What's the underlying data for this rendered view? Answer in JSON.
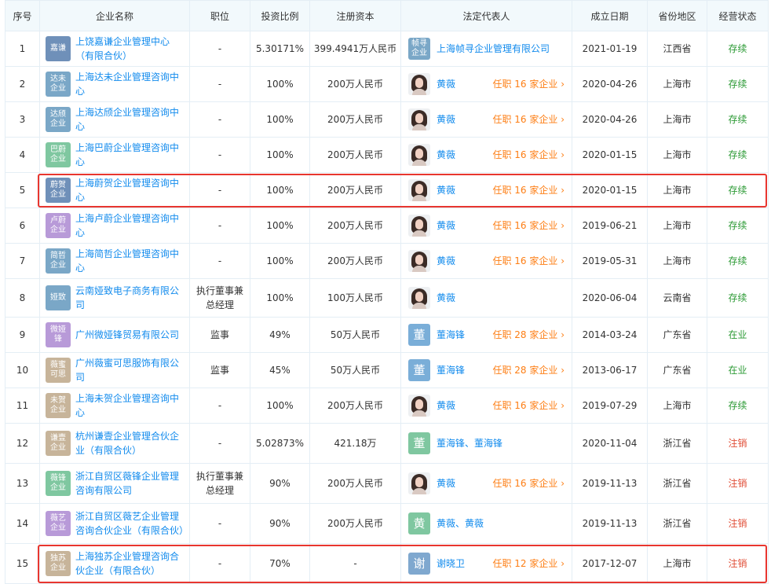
{
  "table": {
    "headers": [
      "序号",
      "企业名称",
      "职位",
      "投资比例",
      "注册资本",
      "法定代表人",
      "成立日期",
      "省份地区",
      "经营状态"
    ],
    "rows": [
      {
        "no": "1",
        "logo_text": "嘉谦",
        "logo_color": "#6f90b9",
        "name": "上饶嘉谦企业管理中心（有限合伙）",
        "position": "-",
        "ratio": "5.30171%",
        "capital": "399.4941万人民币",
        "rep_avatar": "帧寻企业",
        "rep_color": "#7aa7c7",
        "rep": "上海帧寻企业管理有限公司",
        "tenure": "",
        "date": "2021-01-19",
        "region": "江西省",
        "status": "存续",
        "status_type": "ok"
      },
      {
        "no": "2",
        "logo_text": "达未企业",
        "logo_color": "#7aa7c7",
        "name": "上海达未企业管理咨询中心",
        "position": "-",
        "ratio": "100%",
        "capital": "200万人民币",
        "rep_avatar": "photo",
        "rep_color": "",
        "rep": "黄薇",
        "tenure": "任职 16 家企业",
        "date": "2020-04-26",
        "region": "上海市",
        "status": "存续",
        "status_type": "ok"
      },
      {
        "no": "3",
        "logo_text": "达颀企业",
        "logo_color": "#7aa7c7",
        "name": "上海达颀企业管理咨询中心",
        "position": "-",
        "ratio": "100%",
        "capital": "200万人民币",
        "rep_avatar": "photo",
        "rep_color": "",
        "rep": "黄薇",
        "tenure": "任职 16 家企业",
        "date": "2020-04-26",
        "region": "上海市",
        "status": "存续",
        "status_type": "ok"
      },
      {
        "no": "4",
        "logo_text": "巴蔚企业",
        "logo_color": "#7fc7a0",
        "name": "上海巴蔚企业管理咨询中心",
        "position": "-",
        "ratio": "100%",
        "capital": "200万人民币",
        "rep_avatar": "photo",
        "rep_color": "",
        "rep": "黄薇",
        "tenure": "任职 16 家企业",
        "date": "2020-01-15",
        "region": "上海市",
        "status": "存续",
        "status_type": "ok"
      },
      {
        "no": "5",
        "logo_text": "蔚贺企业",
        "logo_color": "#6f90b9",
        "name": "上海蔚贺企业管理咨询中心",
        "position": "-",
        "ratio": "100%",
        "capital": "200万人民币",
        "rep_avatar": "photo",
        "rep_color": "",
        "rep": "黄薇",
        "tenure": "任职 16 家企业",
        "date": "2020-01-15",
        "region": "上海市",
        "status": "存续",
        "status_type": "ok"
      },
      {
        "no": "6",
        "logo_text": "卢蔚企业",
        "logo_color": "#b89ad8",
        "name": "上海卢蔚企业管理咨询中心",
        "position": "-",
        "ratio": "100%",
        "capital": "200万人民币",
        "rep_avatar": "photo",
        "rep_color": "",
        "rep": "黄薇",
        "tenure": "任职 16 家企业",
        "date": "2019-06-21",
        "region": "上海市",
        "status": "存续",
        "status_type": "ok"
      },
      {
        "no": "7",
        "logo_text": "简哲企业",
        "logo_color": "#7aa7c7",
        "name": "上海简哲企业管理咨询中心",
        "position": "-",
        "ratio": "100%",
        "capital": "200万人民币",
        "rep_avatar": "photo",
        "rep_color": "",
        "rep": "黄薇",
        "tenure": "任职 16 家企业",
        "date": "2019-05-31",
        "region": "上海市",
        "status": "存续",
        "status_type": "ok"
      },
      {
        "no": "8",
        "logo_text": "娅致",
        "logo_color": "#7aa7c7",
        "name": "云南娅致电子商务有限公司",
        "position": "执行董事兼总经理",
        "ratio": "100%",
        "capital": "100万人民币",
        "rep_avatar": "photo",
        "rep_color": "",
        "rep": "黄薇",
        "tenure": "",
        "date": "2020-06-04",
        "region": "云南省",
        "status": "存续",
        "status_type": "ok"
      },
      {
        "no": "9",
        "logo_text": "微娅锋",
        "logo_color": "#b89ad8",
        "name": "广州微娅锋贸易有限公司",
        "position": "监事",
        "ratio": "49%",
        "capital": "50万人民币",
        "rep_avatar": "董",
        "rep_color": "#7aaed8",
        "rep": "董海锋",
        "tenure": "任职 28 家企业",
        "date": "2014-03-24",
        "region": "广东省",
        "status": "在业",
        "status_type": "ok"
      },
      {
        "no": "10",
        "logo_text": "薇蜜可思",
        "logo_color": "#c7b49a",
        "name": "广州薇蜜可思服饰有限公司",
        "position": "监事",
        "ratio": "45%",
        "capital": "50万人民币",
        "rep_avatar": "董",
        "rep_color": "#7aaed8",
        "rep": "董海锋",
        "tenure": "任职 28 家企业",
        "date": "2013-06-17",
        "region": "广东省",
        "status": "在业",
        "status_type": "ok"
      },
      {
        "no": "11",
        "logo_text": "未贺企业",
        "logo_color": "#c7b49a",
        "name": "上海未贺企业管理咨询中心",
        "position": "-",
        "ratio": "100%",
        "capital": "200万人民币",
        "rep_avatar": "photo",
        "rep_color": "",
        "rep": "黄薇",
        "tenure": "任职 16 家企业",
        "date": "2019-07-29",
        "region": "上海市",
        "status": "存续",
        "status_type": "ok"
      },
      {
        "no": "12",
        "logo_text": "谦壹企业",
        "logo_color": "#c7b49a",
        "name": "杭州谦壹企业管理合伙企业（有限合伙）",
        "position": "-",
        "ratio": "5.02873%",
        "capital": "421.18万",
        "rep_avatar": "董",
        "rep_color": "#7fc7a0",
        "rep": "董海锋、董海锋",
        "tenure": "",
        "date": "2020-11-04",
        "region": "浙江省",
        "status": "注销",
        "status_type": "bad"
      },
      {
        "no": "13",
        "logo_text": "薇锋企业",
        "logo_color": "#7fc7a0",
        "name": "浙江自贸区薇锋企业管理咨询有限公司",
        "position": "执行董事兼总经理",
        "ratio": "90%",
        "capital": "200万人民币",
        "rep_avatar": "photo",
        "rep_color": "",
        "rep": "黄薇",
        "tenure": "任职 16 家企业",
        "date": "2019-11-13",
        "region": "浙江省",
        "status": "注销",
        "status_type": "bad"
      },
      {
        "no": "14",
        "logo_text": "薇艺企业",
        "logo_color": "#b89ad8",
        "name": "浙江自贸区薇艺企业管理咨询合伙企业（有限合伙）",
        "position": "-",
        "ratio": "90%",
        "capital": "200万人民币",
        "rep_avatar": "黄",
        "rep_color": "#7fc7a0",
        "rep": "黄薇、黄薇",
        "tenure": "",
        "date": "2019-11-13",
        "region": "浙江省",
        "status": "注销",
        "status_type": "bad"
      },
      {
        "no": "15",
        "logo_text": "独苏企业",
        "logo_color": "#c7b49a",
        "name": "上海独苏企业管理咨询合伙企业（有限合伙）",
        "position": "-",
        "ratio": "70%",
        "capital": "-",
        "rep_avatar": "谢",
        "rep_color": "#7fa8cf",
        "rep": "谢晓卫",
        "tenure": "任职 12 家企业",
        "date": "2017-12-07",
        "region": "上海市",
        "status": "注销",
        "status_type": "bad"
      }
    ]
  },
  "highlight_rows": [
    "5",
    "15"
  ]
}
